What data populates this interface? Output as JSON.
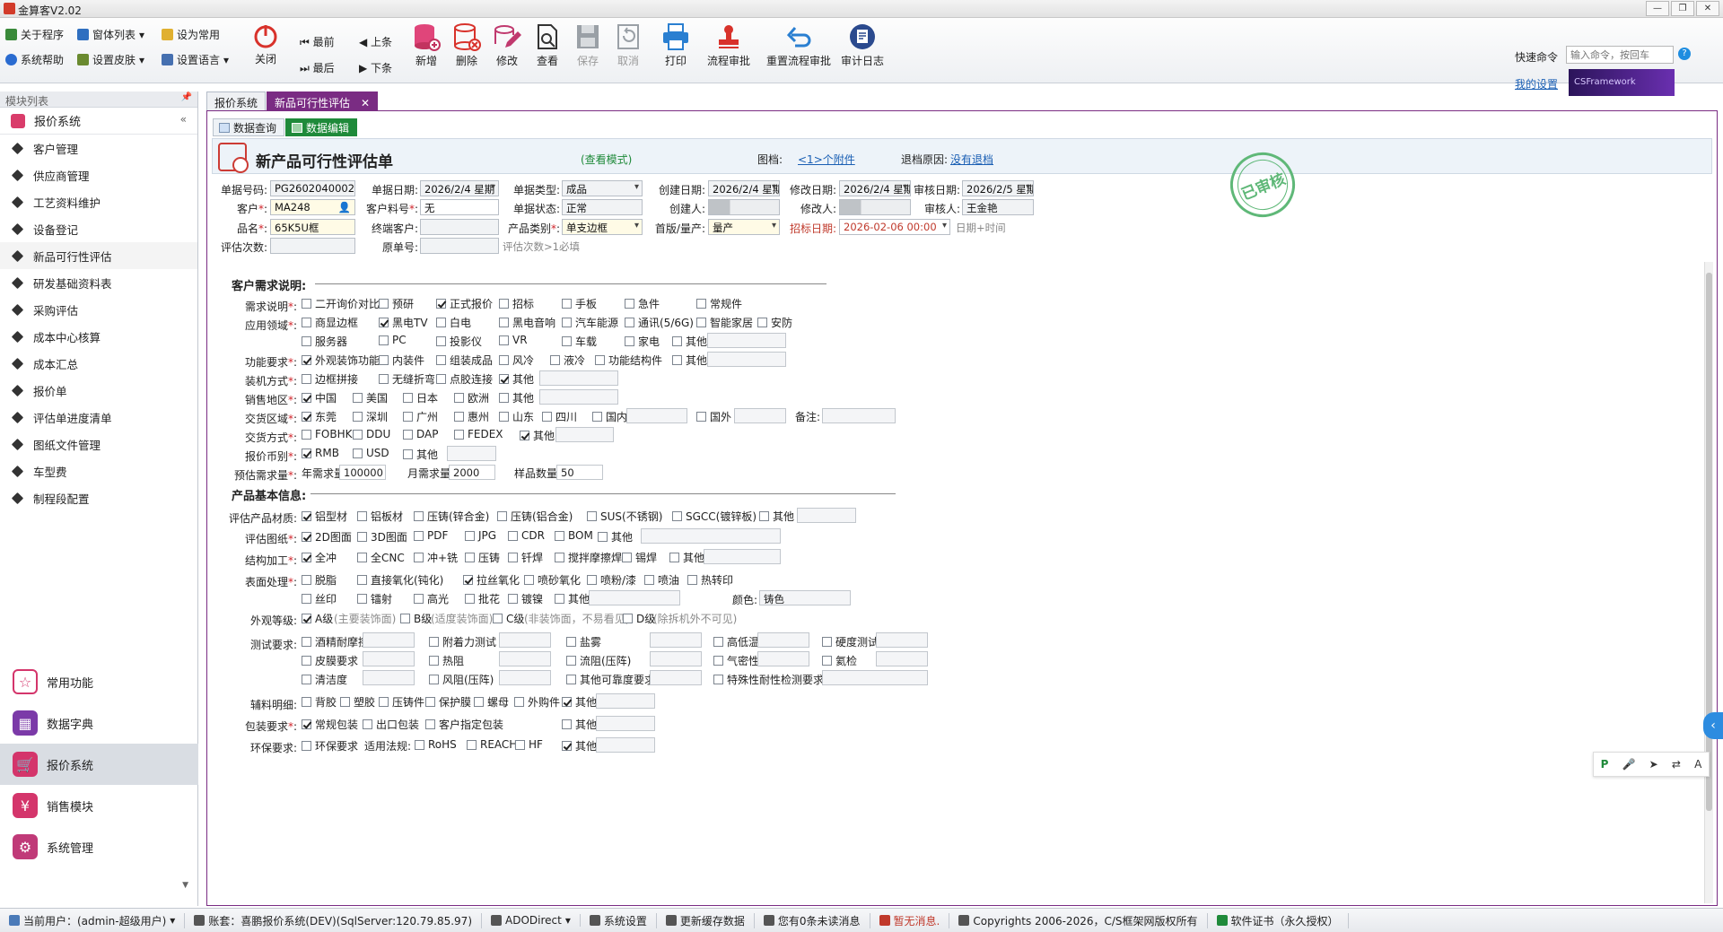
{
  "window": {
    "title": "金算客V2.02"
  },
  "toolbar": {
    "about": "关于程序",
    "window_list": "窗体列表",
    "set_common": "设为常用",
    "help": "系统帮助",
    "skin": "设置皮肤",
    "lang": "设置语言",
    "close": "关闭",
    "first": "最前",
    "last": "最后",
    "prev": "上条",
    "next": "下条",
    "add": "新增",
    "del": "删除",
    "edit": "修改",
    "view": "查看",
    "save": "保存",
    "cancel": "取消",
    "print": "打印",
    "flow": "流程审批",
    "reset_flow": "重置流程审批",
    "audit_log": "审计日志",
    "quick_cmd": "快速命令",
    "quick_placeholder": "输入命令，按回车",
    "my_settings": "我的设置",
    "brand": "CSFramework"
  },
  "sidebar": {
    "header": "模块列表",
    "group": "报价系统",
    "items": [
      "客户管理",
      "供应商管理",
      "工艺资料维护",
      "设备登记",
      "新品可行性评估",
      "研发基础资料表",
      "采购评估",
      "成本中心核算",
      "成本汇总",
      "报价单",
      "评估单进度清单",
      "图纸文件管理",
      "车型费",
      "制程段配置"
    ],
    "bottom": [
      "常用功能",
      "数据字典",
      "报价系统",
      "销售模块",
      "系统管理"
    ]
  },
  "tabs": {
    "t1": "报价系统",
    "t2": "新品可行性评估",
    "sub1": "数据查询",
    "sub2": "数据编辑"
  },
  "form": {
    "title": "新产品可行性评估单",
    "mode": "(查看模式)",
    "attach_lbl": "图档:",
    "attach": "<1>个附件",
    "return_lbl": "退档原因:",
    "return": "没有退档",
    "l_no": "单据号码:",
    "v_no": "PG2602040002",
    "l_date": "单据日期:",
    "v_date": "2026/2/4 星期",
    "l_type": "单据类型:",
    "v_type": "成品",
    "l_cdate": "创建日期:",
    "v_cdate": "2026/2/4 星期",
    "l_mdate": "修改日期:",
    "v_mdate": "2026/2/4 星期",
    "l_adate": "审核日期:",
    "v_adate": "2026/2/5 星期",
    "l_cust": "客户",
    "v_cust": "MA248",
    "l_custno": "客户料号",
    "v_custno": "无",
    "l_status": "单据状态:",
    "v_status": "正常",
    "l_creator": "创建人:",
    "l_modifier": "修改人:",
    "l_auditor": "审核人:",
    "v_auditor": "王金艳",
    "l_name": "品名",
    "v_name": "65K5U框",
    "l_endcust": "终端客户:",
    "l_cat": "产品类别",
    "v_cat": "单支边框",
    "l_batch": "首版/量产:",
    "v_batch": "量产",
    "l_bid": "招标日期:",
    "v_bid": "2026-02-06 00:00",
    "bid_hint": "日期+时间",
    "l_count": "评估次数:",
    "l_orig": "原单号:",
    "count_hint": "评估次数>1必填",
    "stamp": "已审核"
  },
  "sec1": {
    "title": "客户需求说明:",
    "r_need": "需求说明",
    "need": [
      "二开询价对比",
      "预研",
      "正式报价",
      "招标",
      "手板",
      "急件",
      "常规件"
    ],
    "r_app": "应用领域",
    "app1": [
      "商显边框",
      "黑电TV",
      "白电",
      "黑电音响",
      "汽车能源",
      "通讯(5/6G)",
      "智能家居",
      "安防"
    ],
    "app2": [
      "服务器",
      "PC",
      "投影仪",
      "VR",
      "车载",
      "家电",
      "其他"
    ],
    "r_func": "功能要求",
    "func": [
      "外观装饰功能",
      "内装件",
      "组装成品",
      "风冷",
      "液冷",
      "功能结构件",
      "其他"
    ],
    "r_assy": "装机方式",
    "assy": [
      "边框拼接",
      "无缝折弯",
      "点胶连接",
      "其他"
    ],
    "r_sale": "销售地区",
    "sale": [
      "中国",
      "美国",
      "日本",
      "欧洲",
      "其他"
    ],
    "r_area": "交货区域",
    "area": [
      "东莞",
      "深圳",
      "广州",
      "惠州",
      "山东",
      "四川",
      "国内",
      "国外"
    ],
    "note": "备注:",
    "r_mode": "交货方式",
    "mode": [
      "FOBHK",
      "DDU",
      "DAP",
      "FEDEX",
      "其他"
    ],
    "r_cur": "报价币别",
    "cur": [
      "RMB",
      "USD",
      "其他"
    ],
    "r_qty": "预估需求量",
    "yq_lbl": "年需求量",
    "yq": "100000",
    "mq_lbl": "月需求量",
    "mq": "2000",
    "sq_lbl": "样品数量",
    "sq": "50"
  },
  "sec2": {
    "title": "产品基本信息:",
    "r_mat": "评估产品材质",
    "mat": [
      "铝型材",
      "铝板材",
      "压铸(锌合金)",
      "压铸(铝合金)",
      "SUS(不锈钢)",
      "SGCC(镀锌板)",
      "其他"
    ],
    "r_draw": "评估图纸",
    "draw": [
      "2D图面",
      "3D图面",
      "PDF",
      "JPG",
      "CDR",
      "BOM",
      "其他"
    ],
    "r_proc": "结构加工",
    "proc": [
      "全冲",
      "全CNC",
      "冲+铣",
      "压铸",
      "钎焊",
      "搅拌摩擦焊",
      "锡焊",
      "其他"
    ],
    "r_surf": "表面处理",
    "surf1": [
      "脱脂",
      "直接氧化(钝化)",
      "拉丝氧化",
      "喷砂氧化",
      "喷粉/漆",
      "喷油",
      "热转印"
    ],
    "surf2": [
      "丝印",
      "镭射",
      "高光",
      "批花",
      "镀镍",
      "其他"
    ],
    "color_lbl": "颜色:",
    "color": "铸色",
    "r_grade": "外观等级",
    "grade": [
      "A级",
      "(主要装饰面)",
      "B级",
      "(适度装饰面)",
      "C级",
      "(非装饰面，不易看见)",
      "D级",
      "(除拆机外不可见)"
    ],
    "r_test": "测试要求",
    "test1": [
      "酒精耐摩擦",
      "附着力测试",
      "盐雾",
      "高低温",
      "硬度测试"
    ],
    "test2": [
      "皮膜要求",
      "热阻",
      "流阻(压阵)",
      "气密性",
      "氦检"
    ],
    "test3": [
      "清洁度",
      "风阻(压阵)",
      "其他可靠度要求",
      "特殊性耐性检测要求"
    ],
    "r_aux": "辅料明细",
    "aux": [
      "背胶",
      "塑胶",
      "压铸件",
      "保护膜",
      "螺母",
      "外购件",
      "其他"
    ],
    "r_pack": "包装要求",
    "pack": [
      "常规包装",
      "出口包装",
      "客户指定包装",
      "其他"
    ],
    "r_env": "环保要求",
    "env_req": "环保要求",
    "law_lbl": "适用法规:",
    "law": [
      "RoHS",
      "REACH",
      "HF",
      "其他"
    ]
  },
  "status": {
    "user": "当前用户：(admin-超级用户)",
    "db": "账套：喜鹏报价系统(DEV)(SqlServer:120.79.85.97)",
    "conn": "ADODirect",
    "sys": "系统设置",
    "cache": "更新缓存数据",
    "msg": "您有0条未读消息",
    "nomsg": "暂无消息.",
    "copy": "Copyrights 2006-2026，C/S框架网版权所有",
    "lic": "软件证书（永久授权）"
  }
}
